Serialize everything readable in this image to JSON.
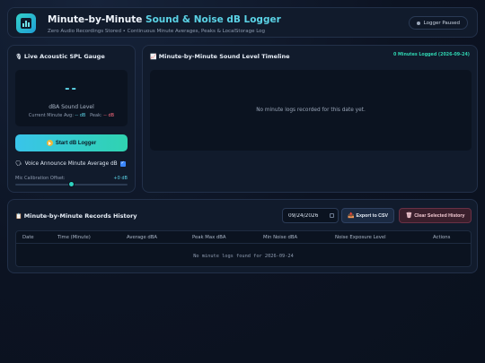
{
  "header": {
    "title_main": "Minute-by-Minute ",
    "title_accent": "Sound & Noise dB Logger",
    "subtitle": "Zero Audio Recordings Stored • Continuous Minute Averages, Peaks & LocalStorage Log",
    "status": "Logger Paused"
  },
  "gauge": {
    "title": "Live Acoustic SPL Gauge",
    "value": "--",
    "unit": "dBA Sound Level",
    "avg_label": "Current Minute Avg:",
    "avg_value": "-- dB",
    "peak_label": "Peak:",
    "peak_value": "-- dB",
    "start_label": "Start dB Logger",
    "voice_label": "Voice Announce Minute Average dB",
    "calib_label": "Mic Calibration Offset:",
    "calib_value": "+0 dB",
    "calib_level": 0.5
  },
  "timeline": {
    "title": "Minute-by-Minute Sound Level Timeline",
    "badge": "0 Minutes Logged (2026-09-24)",
    "empty": "No minute logs recorded for this date yet."
  },
  "history": {
    "title": "Minute-by-Minute Records History",
    "date_value": "09/24/2026",
    "export_label": "Export to CSV",
    "clear_label": "Clear Selected History",
    "columns": [
      "Date",
      "Time (Minute)",
      "Average dBA",
      "Peak Max dBA",
      "Min Noise dBA",
      "Noise Exposure Level",
      "Actions"
    ],
    "empty": "No minute logs found for 2026-09-24"
  }
}
